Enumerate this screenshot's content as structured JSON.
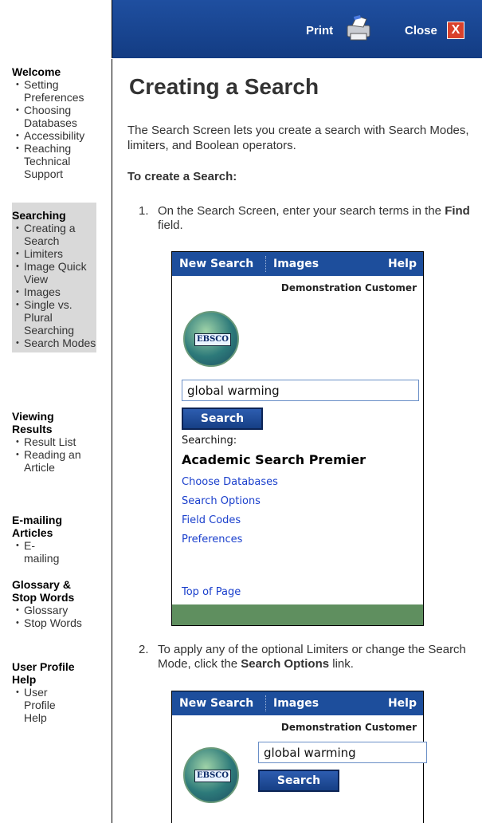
{
  "topbar": {
    "print_label": "Print",
    "close_label": "Close",
    "close_glyph": "X"
  },
  "sidebar": {
    "sections": [
      {
        "title": "Welcome",
        "items": [
          "Setting Preferences",
          "Choosing Databases",
          "Accessibility",
          "Reaching Technical Support"
        ]
      },
      {
        "title": "Searching",
        "items": [
          "Creating a Search",
          "Limiters",
          "Image Quick View",
          "Images",
          "Single vs. Plural Searching",
          "Search Modes"
        ]
      },
      {
        "title": "Viewing Results",
        "items": [
          "Result List",
          "Reading an Article"
        ]
      },
      {
        "title": "E-mailing Articles",
        "items": [
          "E-mailing"
        ]
      },
      {
        "title": "Glossary & Stop Words",
        "items": [
          "Glossary",
          "Stop Words"
        ]
      },
      {
        "title": "User Profile Help",
        "items": [
          "User Profile Help"
        ]
      }
    ]
  },
  "main": {
    "title": "Creating a Search",
    "intro": "The Search Screen lets you create a search with Search Modes, limiters, and Boolean operators.",
    "subhead": "To create a Search:",
    "steps": [
      {
        "num": "1.",
        "pre": "On the Search Screen, enter your search terms in the ",
        "bold": "Find",
        "post": " field."
      },
      {
        "num": "2.",
        "pre": "To apply any of the optional Limiters or change the Search Mode, click the ",
        "bold": "Search Options",
        "post": " link."
      }
    ]
  },
  "mock1": {
    "nav_new": "New Search",
    "nav_images": "Images",
    "nav_help": "Help",
    "customer": "Demonstration Customer",
    "logo_text": "EBSCO",
    "search_value": "global warming",
    "search_button": "Search",
    "searching_label": "Searching:",
    "database": "Academic Search Premier",
    "links": [
      "Choose Databases",
      "Search Options",
      "Field Codes",
      "Preferences"
    ],
    "top_of_page": "Top of Page"
  },
  "mock2": {
    "nav_new": "New Search",
    "nav_images": "Images",
    "nav_help": "Help",
    "customer": "Demonstration Customer",
    "logo_text": "EBSCO",
    "search_value": "global warming",
    "search_button": "Search"
  },
  "colors": {
    "topbar_blue": "#1a4593",
    "nav_blue": "#1d4e9c",
    "link_blue": "#1a3fcc",
    "footer_green": "#5f8f5f",
    "sidebar_active": "#d9d9d9",
    "close_red": "#d9412c"
  }
}
